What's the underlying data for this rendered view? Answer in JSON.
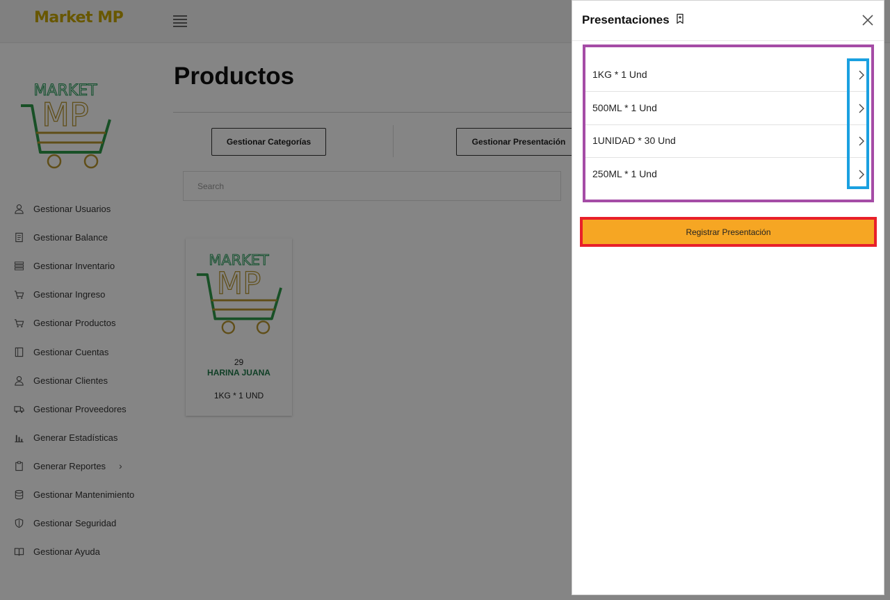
{
  "app": {
    "brand": "Market MP"
  },
  "sidebar": {
    "items": [
      {
        "label": "Gestionar Usuarios",
        "icon": "user-icon"
      },
      {
        "label": "Gestionar Balance",
        "icon": "document-icon"
      },
      {
        "label": "Gestionar Inventario",
        "icon": "list-icon"
      },
      {
        "label": "Gestionar Ingreso",
        "icon": "cart-icon"
      },
      {
        "label": "Gestionar Productos",
        "icon": "cart-icon"
      },
      {
        "label": "Gestionar Cuentas",
        "icon": "ledger-icon"
      },
      {
        "label": "Gestionar Clientes",
        "icon": "user-icon"
      },
      {
        "label": "Gestionar Proveedores",
        "icon": "truck-icon"
      },
      {
        "label": "Generar Estadísticas",
        "icon": "bar-chart-icon"
      },
      {
        "label": "Generar Reportes",
        "icon": "clipboard-icon"
      },
      {
        "label": "Gestionar Mantenimiento",
        "icon": "database-icon"
      },
      {
        "label": "Gestionar Seguridad",
        "icon": "shield-icon"
      },
      {
        "label": "Gestionar Ayuda",
        "icon": "book-icon"
      }
    ]
  },
  "main": {
    "title": "Productos",
    "buttons": {
      "categories": "Gestionar Categorías",
      "presentations": "Gestionar Presentación"
    },
    "search": {
      "placeholder": "Search",
      "value": ""
    },
    "products": [
      {
        "quantity": "29",
        "name": "HARINA JUANA",
        "presentation": "1KG * 1 UND"
      }
    ]
  },
  "drawer": {
    "title": "Presentaciones",
    "presentations": [
      {
        "label": "1KG * 1 Und"
      },
      {
        "label": "500ML * 1 Und"
      },
      {
        "label": "1UNIDAD * 30 Und"
      },
      {
        "label": "250ML * 1 Und"
      }
    ],
    "register_button": "Registrar Presentación"
  },
  "colors": {
    "brand": "#c8a800",
    "register_button": "#f6a623",
    "product_name": "#1f7a4a",
    "highlight_purple": "#a54ca6",
    "highlight_blue": "#1aa0e0",
    "highlight_red": "#e8202a"
  }
}
